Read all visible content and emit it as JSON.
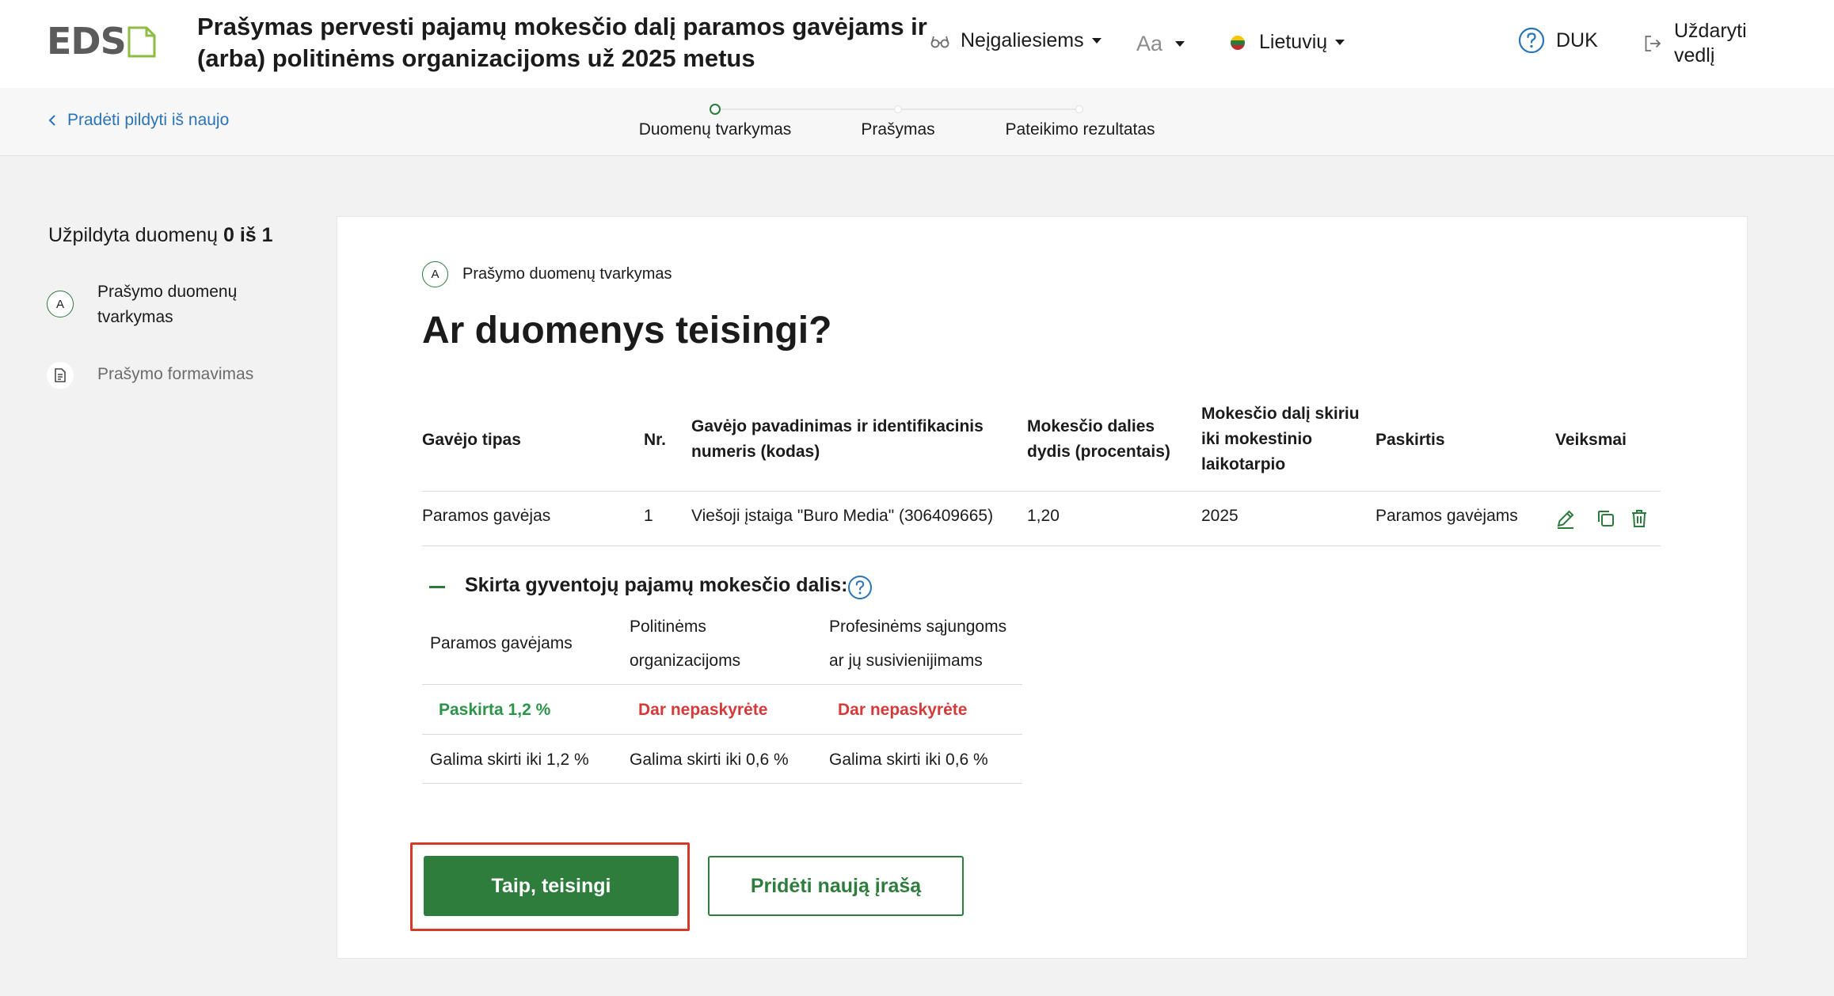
{
  "app": {
    "logo_text": "EDS",
    "title": "Prašymas pervesti pajamų mokesčio dalį paramos gavėjams ir (arba) politinėms organizacijoms už 2025 metus"
  },
  "header": {
    "accessibility_label": "Neįgaliesiems",
    "font_size_label": "Aa",
    "language_label": "Lietuvių",
    "faq_label": "DUK",
    "close_label": "Uždaryti vedlį"
  },
  "subheader": {
    "back_label": "Pradėti pildyti iš naujo",
    "steps": [
      {
        "label": "Duomenų tvarkymas",
        "state": "current"
      },
      {
        "label": "Prašymas",
        "state": "upcoming"
      },
      {
        "label": "Pateikimo rezultatas",
        "state": "upcoming"
      }
    ]
  },
  "sidebar": {
    "progress_prefix": "Užpildyta duomenų",
    "progress_value": "0 iš 1",
    "items": [
      {
        "badge": "A",
        "label": "Prašymo duomenų tvarkymas",
        "state": "active"
      },
      {
        "icon": "document-icon",
        "label": "Prašymo formavimas",
        "state": "inactive"
      }
    ]
  },
  "main": {
    "section_badge": "A",
    "section_label": "Prašymo duomenų tvarkymas",
    "heading": "Ar duomenys teisingi?",
    "table": {
      "headers": [
        "Gavėjo tipas",
        "Nr.",
        "Gavėjo pavadinimas ir identifikacinis numeris (kodas)",
        "Mokesčio dalies dydis (procentais)",
        "Mokesčio dalį skiriu iki mokestinio laikotarpio",
        "Paskirtis",
        "Veiksmai"
      ],
      "rows": [
        [
          "Paramos gavėjas",
          "1",
          "Viešoji įstaiga \"Buro Media\" (306409665)",
          "1,20",
          "2025",
          "Paramos gavėjams"
        ]
      ],
      "actions": [
        "edit-icon",
        "copy-icon",
        "delete-icon"
      ]
    },
    "summary": {
      "title": "Skirta gyventojų pajamų mokesčio dalis:",
      "columns": [
        "Paramos gavėjams",
        "Politinėms organizacijoms",
        "Profesinėms sąjungoms ar jų susivienijimams"
      ],
      "status": [
        "Paskirta 1,2 %",
        "Dar nepaskyrėte",
        "Dar nepaskyrėte"
      ],
      "limits": [
        "Galima skirti iki 1,2 %",
        "Galima skirti iki 0,6 %",
        "Galima skirti iki 0,6 %"
      ]
    },
    "buttons": {
      "confirm": "Taip, teisingi",
      "add_new": "Pridėti naują įrašą"
    }
  },
  "colors": {
    "brand_green": "#2e7d3d",
    "status_green": "#2b9448",
    "status_red": "#d43a3a",
    "link_blue": "#2a74b8",
    "focus_red": "#d33a2a",
    "logo_accent": "#8cbd3f"
  }
}
